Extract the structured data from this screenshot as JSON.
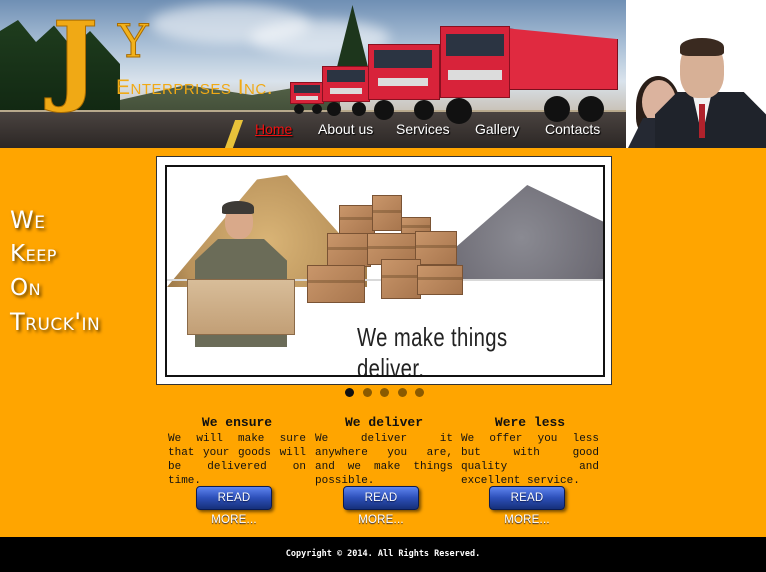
{
  "brand": {
    "logo_mark": "JY",
    "logo_letter_j": "J",
    "logo_letter_y": "Y",
    "company_name": "Enterprises Inc."
  },
  "nav": {
    "items": [
      {
        "label": "Home",
        "active": true
      },
      {
        "label": "About us",
        "active": false
      },
      {
        "label": "Services",
        "active": false
      },
      {
        "label": "Gallery",
        "active": false
      },
      {
        "label": "Contacts",
        "active": false
      }
    ]
  },
  "slogan": {
    "lines": [
      "We",
      "Keep",
      "On",
      "Truck'in"
    ]
  },
  "slider": {
    "caption": "We make things deliver.",
    "slide_count": 5,
    "active_slide": 1
  },
  "features": [
    {
      "title": "We ensure",
      "text": "We will make sure that your goods will be delivered on time.",
      "button": "READ MORE..."
    },
    {
      "title": "We deliver",
      "text": "We deliver it anywhere you are, and we make things possible.",
      "button": "READ MORE..."
    },
    {
      "title": "Were less",
      "text": "We offer you less but with good quality and excellent service.",
      "button": "READ MORE..."
    }
  ],
  "footer": {
    "copyright": "Copyright © 2014. All Rights Reserved."
  },
  "colors": {
    "background": "#FFA500",
    "logo": "#F0A915",
    "nav_active": "#EE1111",
    "footer": "#000000",
    "button": "#2C4FB8",
    "truck": "#D8233A"
  },
  "icons": {
    "slider_dots": "dot-indicator"
  }
}
